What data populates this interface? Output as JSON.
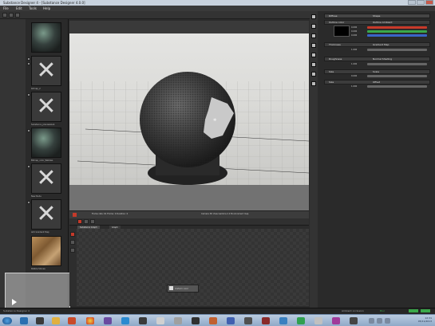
{
  "window": {
    "title": "Substance Designer 4 - [Substance Designer 4.0.0]"
  },
  "menu": [
    "File",
    "Edit",
    "Tools",
    "Help"
  ],
  "library": {
    "slots": [
      {
        "label": "",
        "kind": "ball"
      },
      {
        "label": "bitmap_2",
        "kind": "x"
      },
      {
        "label": "Substance_previewslab",
        "kind": "x"
      },
      {
        "label": "Bitmap_color_Pebbles",
        "kind": "ball"
      },
      {
        "label": "New Node",
        "kind": "x"
      },
      {
        "label": "Add Gradient Map",
        "kind": "x"
      },
      {
        "label": "Pebble Stones",
        "kind": "wood"
      }
    ]
  },
  "viewport": {
    "status_left": "Frame rate: 61   Frame: 0   Duration: 0",
    "status_right": "Camera 3D View   Gamma 2.2   Environment map"
  },
  "graph": {
    "tabs": [
      "Substance Graph",
      "Graph"
    ],
    "node_label": "Uniform color"
  },
  "properties": {
    "header_left": "Diffuse",
    "header_right": "Shape",
    "rows": [
      {
        "label": "Outline color",
        "value": "Outline Ambient"
      },
      {
        "label": "Thickness",
        "value": "Gradient Map"
      },
      {
        "label": "Roughness",
        "value": "Normal Shading"
      },
      {
        "label": "Size",
        "value": "Scale"
      },
      {
        "label": "Size",
        "value": "Offset"
      }
    ],
    "values": [
      "0.000",
      "0.000",
      "0.000",
      "1.000",
      "1.000",
      "0.000",
      "1.000"
    ]
  },
  "status": {
    "left": "Substance Designer 4",
    "right_a": "Ambient occlusion",
    "right_b": "Blur"
  },
  "taskbar": {
    "time": "12:31",
    "date": "05/11/2013"
  },
  "colors": {
    "red": "#c83a2a",
    "green": "#3aa84a",
    "blue": "#3a64c8"
  }
}
